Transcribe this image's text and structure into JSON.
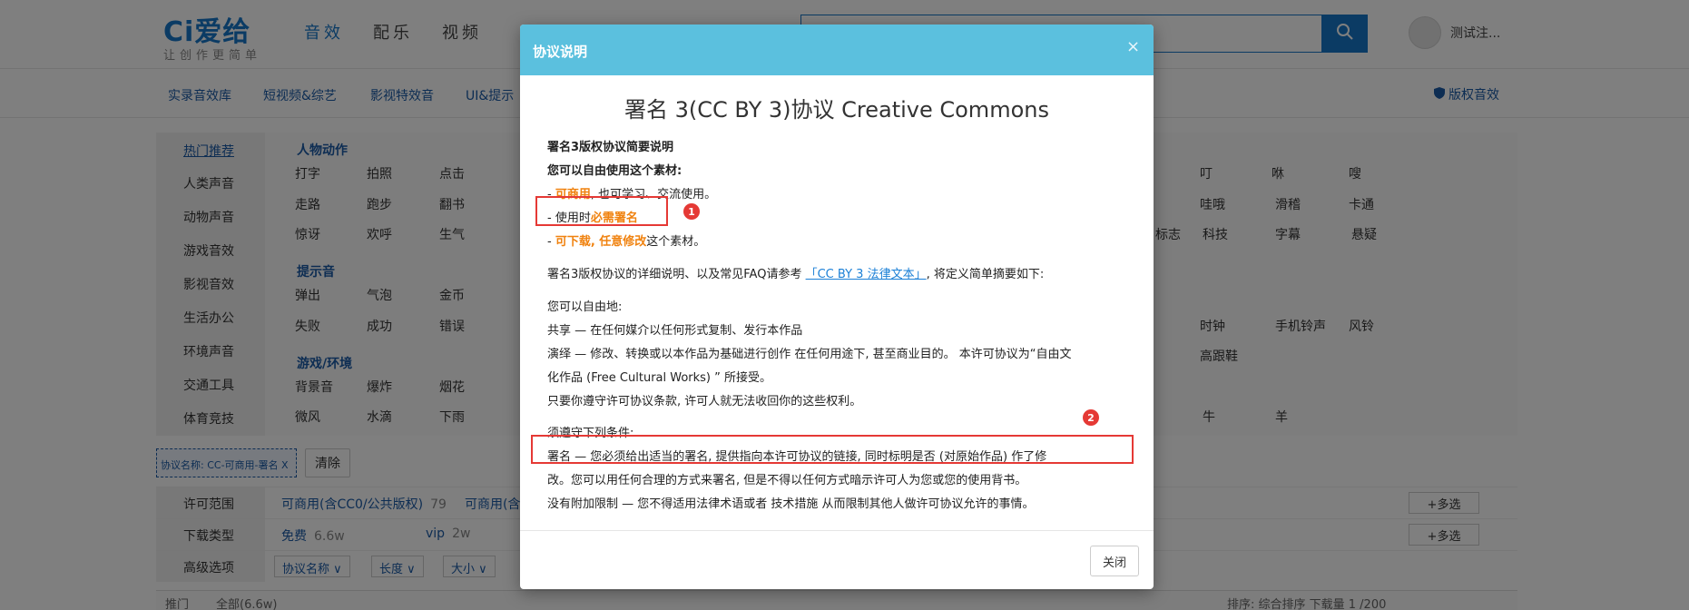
{
  "header": {
    "logo_text": "Ci爱给",
    "logo_slogan": "让创作更简单",
    "nav": [
      "音效",
      "配乐",
      "视频"
    ],
    "search_placeholder": "",
    "user_name": "测试注..."
  },
  "subnav": {
    "items": [
      "实录音效库",
      "短视频&综艺",
      "影视特效音",
      "UI&提示"
    ],
    "right_label": "版权音效"
  },
  "categories": {
    "sidebar": [
      "热门推荐",
      "人类声音",
      "动物声音",
      "游戏音效",
      "影视音效",
      "生活办公",
      "环境声音",
      "交通工具",
      "体育竞技"
    ],
    "groups": [
      {
        "title": "人物动作",
        "rows": [
          [
            "打字",
            "拍照",
            "点击"
          ],
          [
            "走路",
            "跑步",
            "翻书"
          ],
          [
            "惊讶",
            "欢呼",
            "生气"
          ]
        ]
      },
      {
        "title": "提示音",
        "rows": [
          [
            "弹出",
            "气泡",
            "金币"
          ],
          [
            "失败",
            "成功",
            "错误"
          ]
        ]
      },
      {
        "title": "游戏/环境",
        "rows": [
          [
            "背景音",
            "爆炸",
            "烟花"
          ],
          [
            "微风",
            "水滴",
            "下雨"
          ]
        ]
      }
    ],
    "right_tags": [
      [
        "叮",
        "咻",
        "嗖"
      ],
      [
        "哇哦",
        "滑稽",
        "卡通"
      ],
      [
        "标志",
        "科技",
        "字幕",
        "悬疑"
      ],
      [
        "时钟",
        "手机铃声",
        "风铃"
      ],
      [
        "高跟鞋"
      ],
      [
        "牛",
        "羊"
      ]
    ]
  },
  "filter": {
    "chip_label": "协议名称: CC-可商用-署名 X",
    "clear_label": "清除"
  },
  "options": {
    "license": {
      "label": "许可范围",
      "values": [
        {
          "text": "可商用(含CC0/公共版权)",
          "count": "79"
        },
        {
          "text": "可商用(含",
          "count": ""
        }
      ],
      "multi": "+多选"
    },
    "download": {
      "label": "下载类型",
      "values": [
        {
          "text": "免费",
          "count": "6.6w"
        },
        {
          "text": "vip",
          "count": "2w"
        }
      ],
      "multi": "+多选"
    },
    "advanced": {
      "label": "高级选项",
      "dropdowns": [
        "协议名称 ∨",
        "长度 ∨",
        "大小 ∨"
      ]
    }
  },
  "bottom": {
    "left": "推门",
    "mid": "全部(6.6w)",
    "right": "排序: 综合排序  下载量  1 /200"
  },
  "modal": {
    "title": "协议说明",
    "close_x": "×",
    "heading": "署名 3(CC BY 3)协议 Creative Commons",
    "summary_title": "署名3版权协议简要说明",
    "can_use": "您可以自由使用这个素材:",
    "item1_prefix": "- ",
    "item1_highlight": "可商用",
    "item1_rest": ", 也可学习、交流使用。",
    "item2_prefix": "- 使用时",
    "item2_highlight": "必需署名",
    "item3_prefix": "- ",
    "item3_highlight": "可下载, 任意修改",
    "item3_rest": "这个素材。",
    "detail_prefix": "署名3版权协议的详细说明、以及常见FAQ请参考 ",
    "detail_link": "「CC BY 3 法律文本」",
    "detail_suffix": ", 将定义简单摘要如下:",
    "free_to": "您可以自由地:",
    "share": "共享 — 在任何媒介以任何形式复制、发行本作品",
    "adapt1": "演绎 — 修改、转换或以本作品为基础进行创作 在任何用途下, 甚至商业目的。 本许可协议为“自由文",
    "adapt2": "化作品 (Free Cultural Works) ” 所接受。",
    "cannot_revoke": "只要你遵守许可协议条款, 许可人就无法收回你的这些权利。",
    "conditions": "须遵守下列条件:",
    "attribution1": "署名 — 您必须给出适当的署名, 提供指向本许可协议的链接, 同时标明是否 (对原始作品) 作了修",
    "attribution2": "改。您可以用任何合理的方式来署名, 但是不得以任何方式暗示许可人为您或您的使用背书。",
    "no_restrictions": "没有附加限制 — 您不得适用法律术语或者 技术措施 从而限制其他人做许可协议允许的事情。",
    "badge1": "1",
    "badge2": "2",
    "close_button": "关闭"
  },
  "colors": {
    "brand": "#1677c9",
    "modal_header": "#5bc0de",
    "highlight": "#f0820f",
    "annotation": "#e53935"
  }
}
